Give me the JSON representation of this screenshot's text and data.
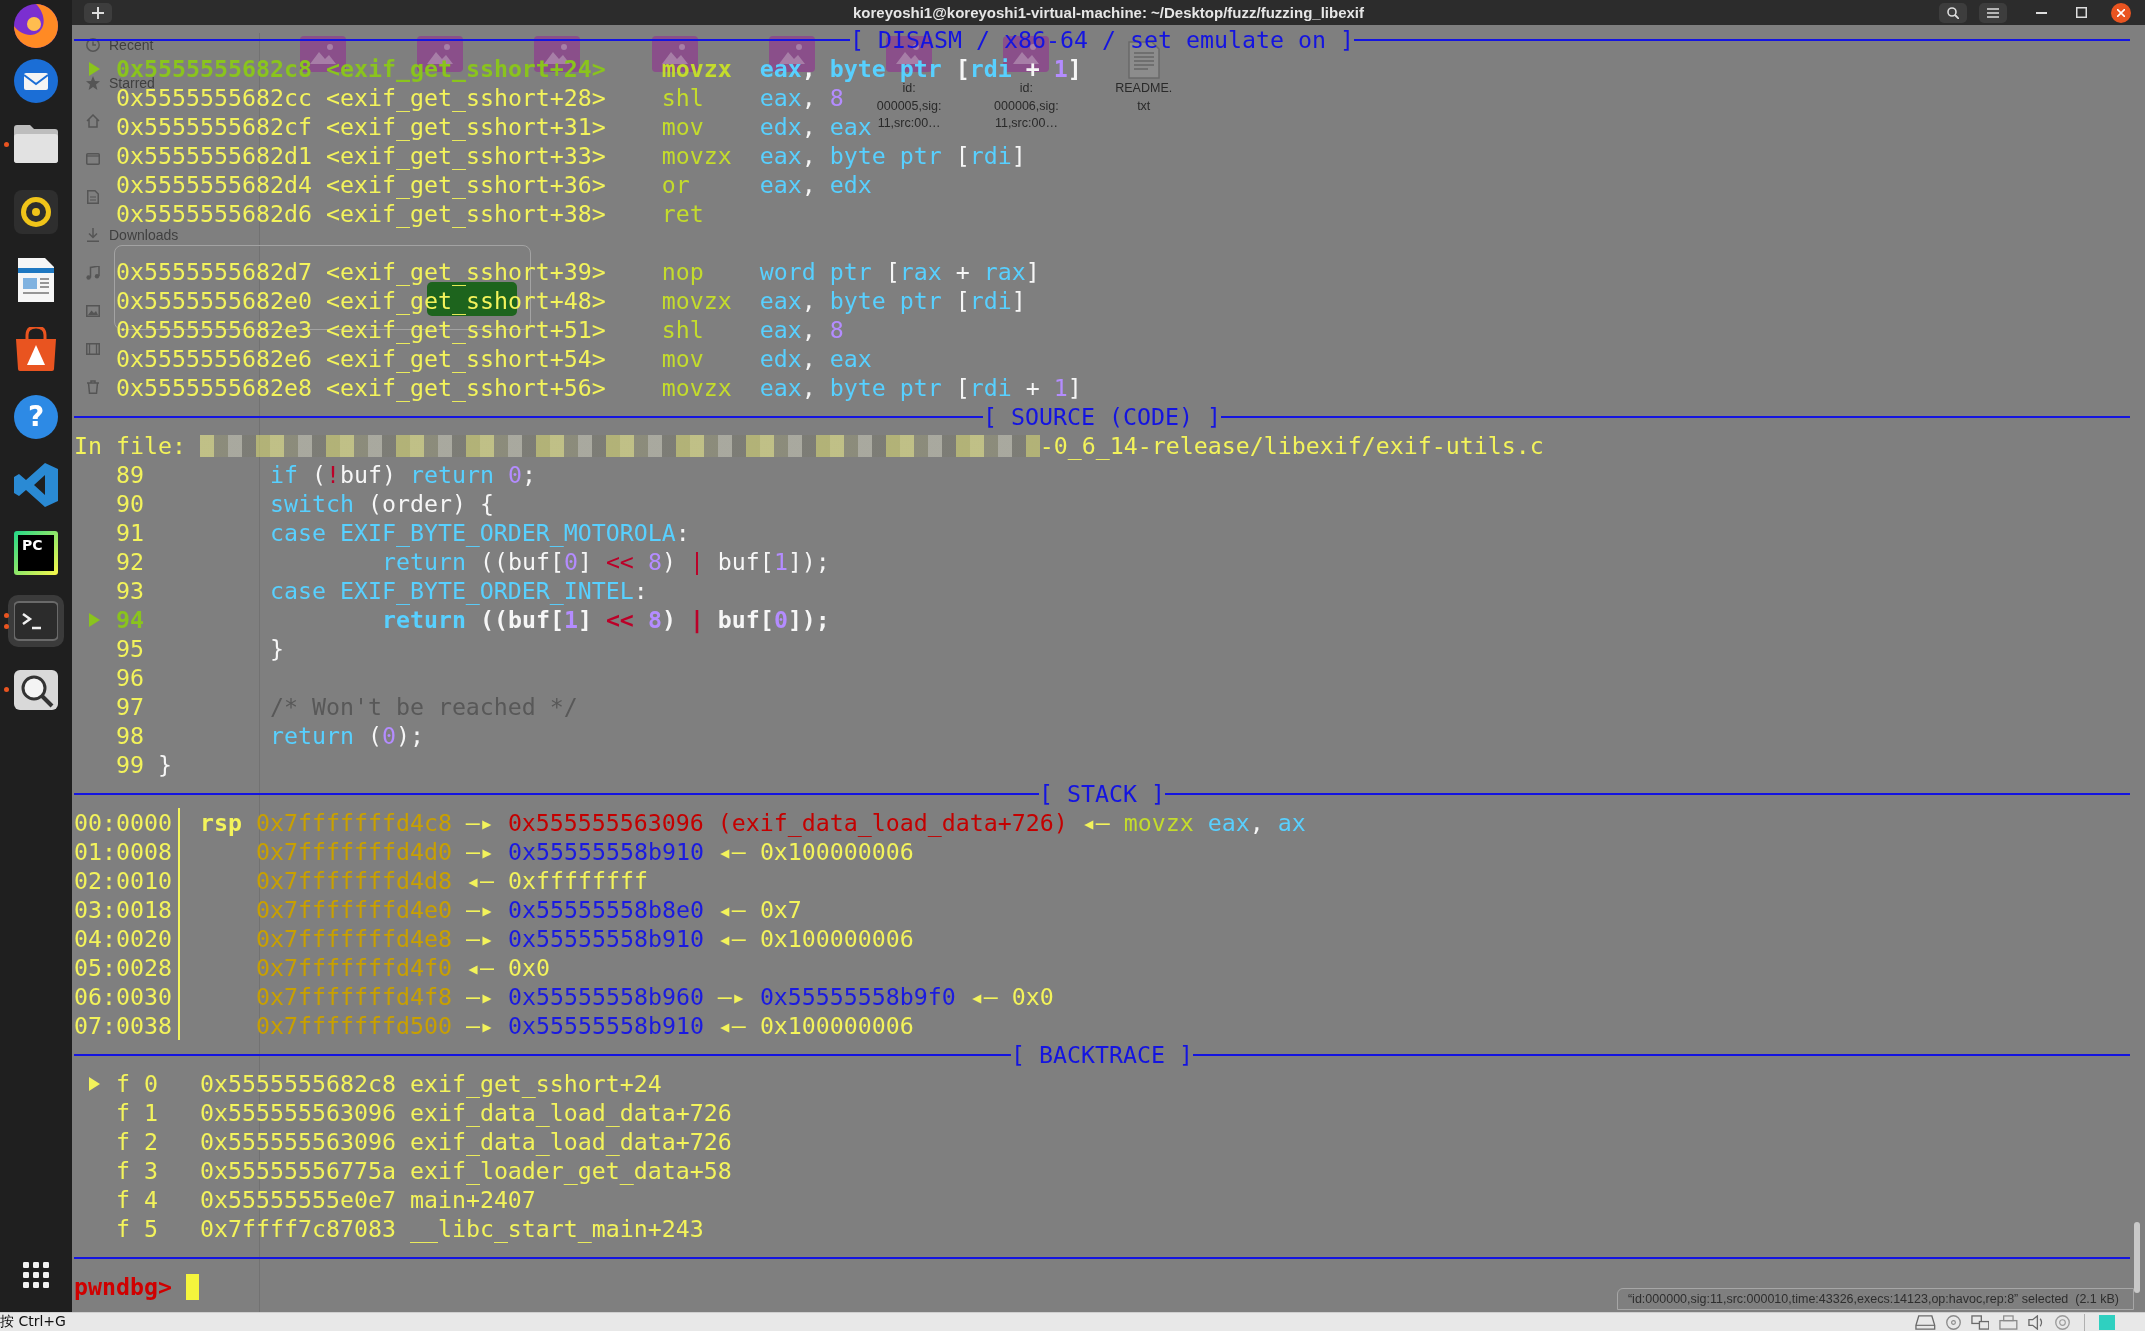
{
  "window": {
    "title": "koreyoshi1@koreyoshi1-virtual-machine: ~/Desktop/fuzz/fuzzing_libexif"
  },
  "dock": {
    "items": [
      {
        "running": false,
        "multiple_windows": false,
        "selected": false
      },
      {
        "running": false,
        "multiple_windows": false,
        "selected": false
      },
      {
        "running": true,
        "multiple_windows": false,
        "selected": false
      },
      {
        "running": false,
        "multiple_windows": false,
        "selected": false
      },
      {
        "running": false,
        "multiple_windows": false,
        "selected": false
      },
      {
        "running": false,
        "multiple_windows": false,
        "selected": false
      },
      {
        "running": false,
        "multiple_windows": false,
        "selected": false,
        "logo_text": "?"
      },
      {
        "running": false,
        "multiple_windows": false,
        "selected": false
      },
      {
        "running": false,
        "multiple_windows": false,
        "selected": false,
        "logo_text": "PC"
      },
      {
        "running": true,
        "multiple_windows": true,
        "selected": true
      },
      {
        "running": true,
        "multiple_windows": false,
        "selected": false
      }
    ]
  },
  "file_manager": {
    "sidebar": [
      {
        "label": "Recent"
      },
      {
        "label": "Starred"
      },
      {
        "label": "Downloads"
      }
    ],
    "files": [
      {
        "kind": "image"
      },
      {
        "kind": "image"
      },
      {
        "kind": "image"
      },
      {
        "kind": "image"
      },
      {
        "kind": "image"
      },
      {
        "kind": "image",
        "name": "id:\n000005,sig:\n11,src:00…"
      },
      {
        "kind": "image",
        "name": "id:\n000006,sig:\n11,src:00…"
      },
      {
        "kind": "text",
        "name": "README.\ntxt"
      }
    ],
    "selection_status": "“id:000000,sig:11,src:000010,time:43326,execs:14123,op:havoc,rep:8” selected  (2.1 kB)"
  },
  "terminal": {
    "disasm": {
      "title": "[ DISASM / x86-64 / set emulate on ]",
      "blocks": [
        {
          "lines": [
            {
              "current": true,
              "address": "0x5555555682c8",
              "symbol": "<exif_get_sshort+24>",
              "mnemonic": "movzx",
              "operands": [
                {
                  "text": "eax",
                  "kind": "register"
                },
                {
                  "text": ", ",
                  "kind": "plain"
                },
                {
                  "text": "byte ptr",
                  "kind": "register"
                },
                {
                  "text": " [",
                  "kind": "plain"
                },
                {
                  "text": "rdi",
                  "kind": "register"
                },
                {
                  "text": " + ",
                  "kind": "plain"
                },
                {
                  "text": "1",
                  "kind": "number"
                },
                {
                  "text": "]",
                  "kind": "plain"
                }
              ]
            },
            {
              "current": false,
              "address": "0x5555555682cc",
              "symbol": "<exif_get_sshort+28>",
              "mnemonic": "shl",
              "operands": [
                {
                  "text": "eax",
                  "kind": "register"
                },
                {
                  "text": ", ",
                  "kind": "plain"
                },
                {
                  "text": "8",
                  "kind": "number"
                }
              ]
            },
            {
              "current": false,
              "address": "0x5555555682cf",
              "symbol": "<exif_get_sshort+31>",
              "mnemonic": "mov",
              "operands": [
                {
                  "text": "edx",
                  "kind": "register"
                },
                {
                  "text": ", ",
                  "kind": "plain"
                },
                {
                  "text": "eax",
                  "kind": "register"
                }
              ]
            },
            {
              "current": false,
              "address": "0x5555555682d1",
              "symbol": "<exif_get_sshort+33>",
              "mnemonic": "movzx",
              "operands": [
                {
                  "text": "eax",
                  "kind": "register"
                },
                {
                  "text": ", ",
                  "kind": "plain"
                },
                {
                  "text": "byte ptr",
                  "kind": "register"
                },
                {
                  "text": " [",
                  "kind": "plain"
                },
                {
                  "text": "rdi",
                  "kind": "register"
                },
                {
                  "text": "]",
                  "kind": "plain"
                }
              ]
            },
            {
              "current": false,
              "address": "0x5555555682d4",
              "symbol": "<exif_get_sshort+36>",
              "mnemonic": "or",
              "operands": [
                {
                  "text": "eax",
                  "kind": "register"
                },
                {
                  "text": ", ",
                  "kind": "plain"
                },
                {
                  "text": "edx",
                  "kind": "register"
                }
              ]
            },
            {
              "current": false,
              "address": "0x5555555682d6",
              "symbol": "<exif_get_sshort+38>",
              "mnemonic": "ret"
            }
          ]
        },
        {
          "lines": [
            {
              "current": false,
              "address": "0x5555555682d7",
              "symbol": "<exif_get_sshort+39>",
              "mnemonic": "nop",
              "operands": [
                {
                  "text": "word ptr",
                  "kind": "register"
                },
                {
                  "text": " [",
                  "kind": "plain"
                },
                {
                  "text": "rax",
                  "kind": "register"
                },
                {
                  "text": " + ",
                  "kind": "plain"
                },
                {
                  "text": "rax",
                  "kind": "register"
                },
                {
                  "text": "]",
                  "kind": "plain"
                }
              ]
            },
            {
              "current": false,
              "address": "0x5555555682e0",
              "symbol": "<exif_get_sshort+48>",
              "mnemonic": "movzx",
              "operands": [
                {
                  "text": "eax",
                  "kind": "register"
                },
                {
                  "text": ", ",
                  "kind": "plain"
                },
                {
                  "text": "byte ptr",
                  "kind": "register"
                },
                {
                  "text": " [",
                  "kind": "plain"
                },
                {
                  "text": "rdi",
                  "kind": "register"
                },
                {
                  "text": "]",
                  "kind": "plain"
                }
              ]
            },
            {
              "current": false,
              "address": "0x5555555682e3",
              "symbol": "<exif_get_sshort+51>",
              "mnemonic": "shl",
              "operands": [
                {
                  "text": "eax",
                  "kind": "register"
                },
                {
                  "text": ", ",
                  "kind": "plain"
                },
                {
                  "text": "8",
                  "kind": "number"
                }
              ]
            },
            {
              "current": false,
              "address": "0x5555555682e6",
              "symbol": "<exif_get_sshort+54>",
              "mnemonic": "mov",
              "operands": [
                {
                  "text": "edx",
                  "kind": "register"
                },
                {
                  "text": ", ",
                  "kind": "plain"
                },
                {
                  "text": "eax",
                  "kind": "register"
                }
              ]
            },
            {
              "current": false,
              "address": "0x5555555682e8",
              "symbol": "<exif_get_sshort+56>",
              "mnemonic": "movzx",
              "operands": [
                {
                  "text": "eax",
                  "kind": "register"
                },
                {
                  "text": ", ",
                  "kind": "plain"
                },
                {
                  "text": "byte ptr",
                  "kind": "register"
                },
                {
                  "text": " [",
                  "kind": "plain"
                },
                {
                  "text": "rdi",
                  "kind": "register"
                },
                {
                  "text": " + ",
                  "kind": "plain"
                },
                {
                  "text": "1",
                  "kind": "number"
                },
                {
                  "text": "]",
                  "kind": "plain"
                }
              ]
            }
          ]
        }
      ]
    },
    "source": {
      "title": "[ SOURCE (CODE) ]",
      "file_label": "In file:",
      "file_path": "-0_6_14-release/libexif/exif-utils.c",
      "lines": [
        {
          "number": "89",
          "current": false,
          "code": [
            {
              "text": "\tif",
              "kind": "keyword"
            },
            {
              "text": " (",
              "kind": "plain"
            },
            {
              "text": "!",
              "kind": "operator"
            },
            {
              "text": "buf) ",
              "kind": "plain"
            },
            {
              "text": "return ",
              "kind": "keyword"
            },
            {
              "text": "0",
              "kind": "number"
            },
            {
              "text": ";",
              "kind": "plain"
            }
          ]
        },
        {
          "number": "90",
          "current": false,
          "code": [
            {
              "text": "\tswitch",
              "kind": "keyword"
            },
            {
              "text": " (order) {",
              "kind": "plain"
            }
          ]
        },
        {
          "number": "91",
          "current": false,
          "code": [
            {
              "text": "\tcase EXIF_BYTE_ORDER_MOTOROLA",
              "kind": "keyword"
            },
            {
              "text": ":",
              "kind": "plain"
            }
          ]
        },
        {
          "number": "92",
          "current": false,
          "code": [
            {
              "text": "\t\treturn",
              "kind": "keyword"
            },
            {
              "text": " ((buf[",
              "kind": "plain"
            },
            {
              "text": "0",
              "kind": "number"
            },
            {
              "text": "] ",
              "kind": "plain"
            },
            {
              "text": "<< ",
              "kind": "operator"
            },
            {
              "text": "8",
              "kind": "number"
            },
            {
              "text": ") ",
              "kind": "plain"
            },
            {
              "text": "|",
              "kind": "operator"
            },
            {
              "text": " buf[",
              "kind": "plain"
            },
            {
              "text": "1",
              "kind": "number"
            },
            {
              "text": "]);",
              "kind": "plain"
            }
          ]
        },
        {
          "number": "93",
          "current": false,
          "code": [
            {
              "text": "\tcase EXIF_BYTE_ORDER_INTEL",
              "kind": "keyword"
            },
            {
              "text": ":",
              "kind": "plain"
            }
          ]
        },
        {
          "number": "94",
          "current": true,
          "code": [
            {
              "text": "\t\treturn",
              "kind": "keyword"
            },
            {
              "text": " ((buf[",
              "kind": "plain"
            },
            {
              "text": "1",
              "kind": "number"
            },
            {
              "text": "] ",
              "kind": "plain"
            },
            {
              "text": "<< ",
              "kind": "operator"
            },
            {
              "text": "8",
              "kind": "number"
            },
            {
              "text": ") ",
              "kind": "plain"
            },
            {
              "text": "|",
              "kind": "operator"
            },
            {
              "text": " buf[",
              "kind": "plain"
            },
            {
              "text": "0",
              "kind": "number"
            },
            {
              "text": "]);",
              "kind": "plain"
            }
          ]
        },
        {
          "number": "95",
          "current": false,
          "code": [
            {
              "text": "\t}",
              "kind": "plain"
            }
          ]
        },
        {
          "number": "96",
          "current": false
        },
        {
          "number": "97",
          "current": false,
          "code": [
            {
              "text": "\t/* Won't be reached */",
              "kind": "comment"
            }
          ]
        },
        {
          "number": "98",
          "current": false,
          "code": [
            {
              "text": "\treturn",
              "kind": "keyword"
            },
            {
              "text": " (",
              "kind": "plain"
            },
            {
              "text": "0",
              "kind": "number"
            },
            {
              "text": ");",
              "kind": "plain"
            }
          ]
        },
        {
          "number": "99",
          "current": false,
          "code": [
            {
              "text": "}",
              "kind": "plain"
            }
          ]
        }
      ]
    },
    "stack": {
      "title": "[ STACK ]",
      "rows": [
        {
          "offset": "00:0000",
          "register": "rsp",
          "chain": [
            {
              "text": "0x7fffffffd4c8",
              "kind": "stack"
            },
            {
              "text": " —▸ ",
              "kind": "arrow"
            },
            {
              "text": "0x555555563096 (exif_data_load_data+726)",
              "kind": "code"
            },
            {
              "text": " ◂— ",
              "kind": "arrow"
            },
            {
              "text": "movzx ",
              "kind": "mnemonic"
            },
            {
              "text": "eax",
              "kind": "register"
            },
            {
              "text": ", ",
              "kind": "plain"
            },
            {
              "text": "ax",
              "kind": "register"
            }
          ]
        },
        {
          "offset": "01:0008",
          "chain": [
            {
              "text": "0x7fffffffd4d0",
              "kind": "stack"
            },
            {
              "text": " —▸ ",
              "kind": "arrow"
            },
            {
              "text": "0x55555558b910",
              "kind": "heap"
            },
            {
              "text": " ◂— ",
              "kind": "arrow"
            },
            {
              "text": "0x100000006",
              "kind": "value"
            }
          ]
        },
        {
          "offset": "02:0010",
          "chain": [
            {
              "text": "0x7fffffffd4d8",
              "kind": "stack"
            },
            {
              "text": " ◂— ",
              "kind": "arrow"
            },
            {
              "text": "0xffffffff",
              "kind": "value"
            }
          ]
        },
        {
          "offset": "03:0018",
          "chain": [
            {
              "text": "0x7fffffffd4e0",
              "kind": "stack"
            },
            {
              "text": " —▸ ",
              "kind": "arrow"
            },
            {
              "text": "0x55555558b8e0",
              "kind": "heap"
            },
            {
              "text": " ◂— ",
              "kind": "arrow"
            },
            {
              "text": "0x7",
              "kind": "value"
            }
          ]
        },
        {
          "offset": "04:0020",
          "chain": [
            {
              "text": "0x7fffffffd4e8",
              "kind": "stack"
            },
            {
              "text": " —▸ ",
              "kind": "arrow"
            },
            {
              "text": "0x55555558b910",
              "kind": "heap"
            },
            {
              "text": " ◂— ",
              "kind": "arrow"
            },
            {
              "text": "0x100000006",
              "kind": "value"
            }
          ]
        },
        {
          "offset": "05:0028",
          "chain": [
            {
              "text": "0x7fffffffd4f0",
              "kind": "stack"
            },
            {
              "text": " ◂— ",
              "kind": "arrow"
            },
            {
              "text": "0x0",
              "kind": "value"
            }
          ]
        },
        {
          "offset": "06:0030",
          "chain": [
            {
              "text": "0x7fffffffd4f8",
              "kind": "stack"
            },
            {
              "text": " —▸ ",
              "kind": "arrow"
            },
            {
              "text": "0x55555558b960",
              "kind": "heap"
            },
            {
              "text": " —▸ ",
              "kind": "arrow"
            },
            {
              "text": "0x55555558b9f0",
              "kind": "heap"
            },
            {
              "text": " ◂— ",
              "kind": "arrow"
            },
            {
              "text": "0x0",
              "kind": "value"
            }
          ]
        },
        {
          "offset": "07:0038",
          "chain": [
            {
              "text": "0x7fffffffd500",
              "kind": "stack"
            },
            {
              "text": " —▸ ",
              "kind": "arrow"
            },
            {
              "text": "0x55555558b910",
              "kind": "heap"
            },
            {
              "text": " ◂— ",
              "kind": "arrow"
            },
            {
              "text": "0x100000006",
              "kind": "value"
            }
          ]
        }
      ]
    },
    "backtrace": {
      "title": "[ BACKTRACE ]",
      "frames": [
        {
          "current": true,
          "frame": "f 0",
          "address": "0x5555555682c8",
          "symbol": "exif_get_sshort+24"
        },
        {
          "current": false,
          "frame": "f 1",
          "address": "0x555555563096",
          "symbol": "exif_data_load_data+726"
        },
        {
          "current": false,
          "frame": "f 2",
          "address": "0x555555563096",
          "symbol": "exif_data_load_data+726"
        },
        {
          "current": false,
          "frame": "f 3",
          "address": "0x55555556775a",
          "symbol": "exif_loader_get_data+58"
        },
        {
          "current": false,
          "frame": "f 4",
          "address": "0x55555555e0e7",
          "symbol": "main+2407"
        },
        {
          "current": false,
          "frame": "f 5",
          "address": "0x7ffff7c87083",
          "symbol": "__libc_start_main+243"
        }
      ]
    },
    "prompt": "pwndbg>"
  },
  "host_bar": {
    "hint": "按 Ctrl+G"
  }
}
